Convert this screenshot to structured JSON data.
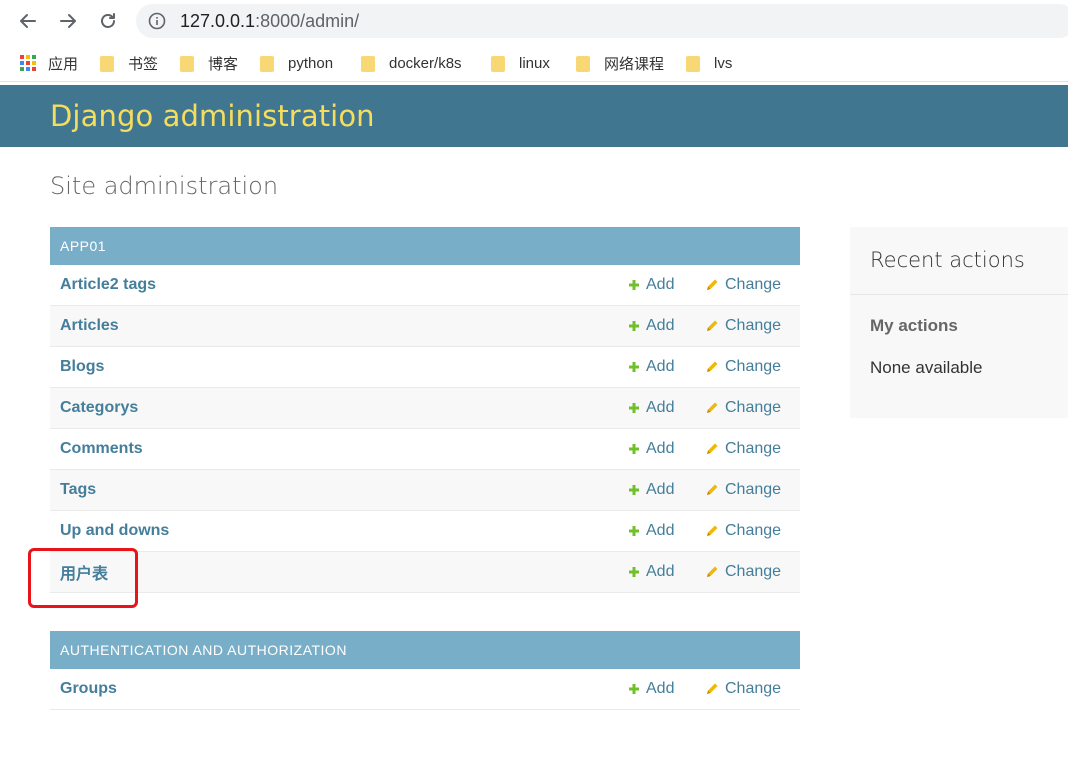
{
  "browser": {
    "url_host": "127.0.0.1",
    "url_rest": ":8000/admin/",
    "bookmarks": [
      {
        "label": "应用",
        "icon": "apps-grid-icon"
      },
      {
        "label": "书签",
        "icon": "folder-icon"
      },
      {
        "label": "博客",
        "icon": "folder-icon"
      },
      {
        "label": "python",
        "icon": "folder-icon"
      },
      {
        "label": "docker/k8s",
        "icon": "folder-icon"
      },
      {
        "label": "linux",
        "icon": "folder-icon"
      },
      {
        "label": "网络课程",
        "icon": "folder-icon"
      },
      {
        "label": "lvs",
        "icon": "folder-icon"
      }
    ]
  },
  "header": {
    "brand": "Django administration"
  },
  "page": {
    "title": "Site administration"
  },
  "modules": [
    {
      "caption": "APP01",
      "rows": [
        {
          "name": "Article2 tags",
          "add": "Add",
          "change": "Change"
        },
        {
          "name": "Articles",
          "add": "Add",
          "change": "Change"
        },
        {
          "name": "Blogs",
          "add": "Add",
          "change": "Change"
        },
        {
          "name": "Categorys",
          "add": "Add",
          "change": "Change"
        },
        {
          "name": "Comments",
          "add": "Add",
          "change": "Change"
        },
        {
          "name": "Tags",
          "add": "Add",
          "change": "Change"
        },
        {
          "name": "Up and downs",
          "add": "Add",
          "change": "Change"
        },
        {
          "name": "用户表",
          "add": "Add",
          "change": "Change"
        }
      ]
    },
    {
      "caption": "Authentication and Authorization",
      "rows": [
        {
          "name": "Groups",
          "add": "Add",
          "change": "Change"
        }
      ]
    }
  ],
  "recent_actions": {
    "title": "Recent actions",
    "subtitle": "My actions",
    "empty": "None available"
  },
  "colors": {
    "header_bg": "#417690",
    "brand": "#f5dd5d",
    "caption_bg": "#79aec8",
    "link": "#447e9b",
    "add_icon": "#70bf2b",
    "change_icon": "#efb80b",
    "highlight": "#e8141a"
  }
}
